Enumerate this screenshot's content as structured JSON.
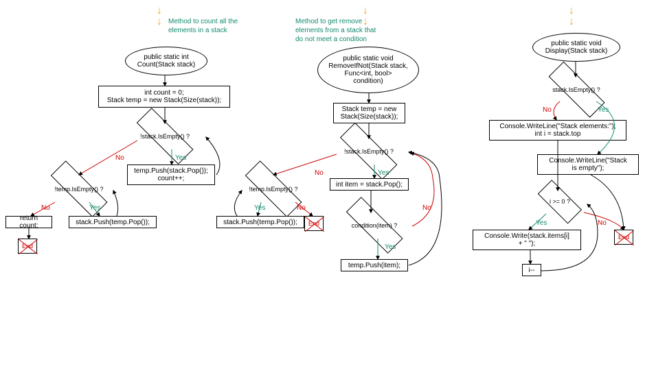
{
  "comments": {
    "c1": "Method to count all the\nelements in a stack",
    "c2": "Method to get remove\nelements from a stack that\ndo not meet a condition",
    "c3": ""
  },
  "chart1": {
    "start": "public static int\nCount(Stack stack)",
    "init": "int count = 0;\nStack temp = new Stack(Size(stack));",
    "cond1": "!stack.IsEmpty()  ?",
    "yes1": "temp.Push(stack.Pop());\ncount++;",
    "cond2": "!temp.IsEmpty()  ?",
    "yes2": "stack.Push(temp.Pop());",
    "return": "return count;",
    "end": "End"
  },
  "chart2": {
    "start": "public static void\nRemoveIfNot(Stack stack,\nFunc<int, bool>\ncondition)",
    "init": "Stack temp = new\nStack(Size(stack));",
    "cond1": "!stack.IsEmpty()  ?",
    "yes1": "int item = stack.Pop();",
    "cond2": "condition(item)  ?",
    "yes2": "temp.Push(item);",
    "cond3": "!temp.IsEmpty()  ?",
    "yes3": "stack.Push(temp.Pop());",
    "end": "End"
  },
  "chart3": {
    "start": "public static void\nDisplay(Stack stack)",
    "cond1": "stack.IsEmpty()  ?",
    "no1": "Console.WriteLine(\"Stack elements:\");\nint i = stack.top",
    "yes1": "Console.WriteLine(\"Stack\nis empty\");",
    "cond2": "i >= 0  ?",
    "yes2": "Console.Write(stack.items[i]\n+ \" \");",
    "dec": "i--",
    "end": "End"
  },
  "labels": {
    "yes": "Yes",
    "no": "No"
  }
}
